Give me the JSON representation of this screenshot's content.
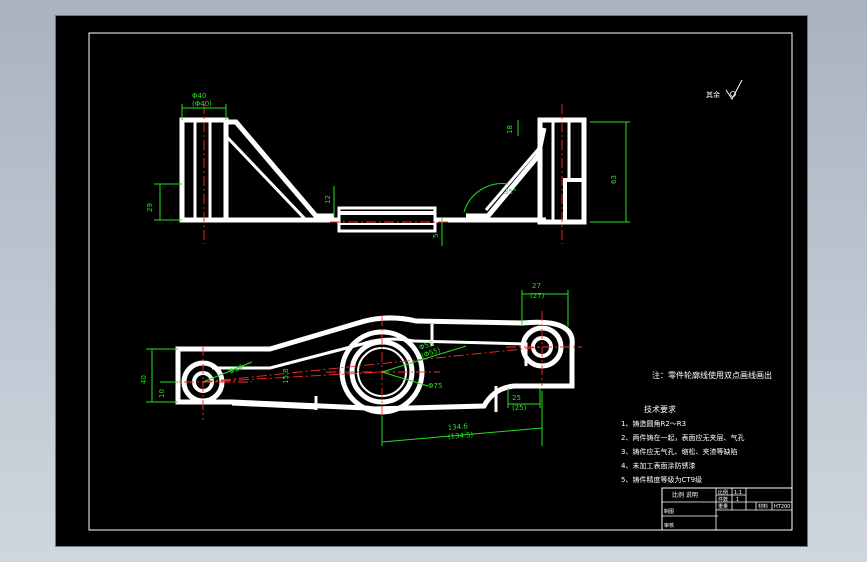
{
  "drawing": {
    "top_view_dims": {
      "d_top": "Φ40",
      "d_top_tol": "(Φ40)",
      "h_right_top": "18",
      "h_right": "63",
      "h_left": "29",
      "thick": "12",
      "web": "5",
      "angle": "35°"
    },
    "bottom_view_dims": {
      "left_h": "40",
      "left_small": "10",
      "right_top": "27",
      "right_top_tol": "(27)",
      "center_bore": "Φ55",
      "center_bore_tol": "(Φ55)",
      "center_bore2": "Φ75",
      "left_bore": "Φ24",
      "left_radius": "15.8",
      "right_small": "25",
      "right_small_tol": "(25)",
      "center_dist": "134.6",
      "center_dist_tol": "(134.5)"
    },
    "note": "注：零件轮廓线使用双点画线画出",
    "tech_req": {
      "title": "技术要求",
      "items": [
        "1、铸造圆角R2～R3",
        "2、两件铸在一起，表面应无夹层、气孔",
        "3、铸件应无气孔、缩松、夹渣等缺陷",
        "4、未加工表面涂防锈漆",
        "5、铸件精度等级为CT9级"
      ]
    },
    "roughness_mark": "其余",
    "title_block": {
      "part_name": "比例 说明",
      "scale_label": "比例",
      "scale_value": "1:1",
      "qty_label": "件数",
      "qty_value": "1",
      "weight_label": "重量",
      "material_label": "材料",
      "material_value": "HT200",
      "drawer_label": "制图",
      "checker_label": "审核"
    }
  },
  "colors": {
    "background": "#000000",
    "outline": "#ffffff",
    "dimension": "#23e020",
    "centerline": "#ff2a2a"
  }
}
